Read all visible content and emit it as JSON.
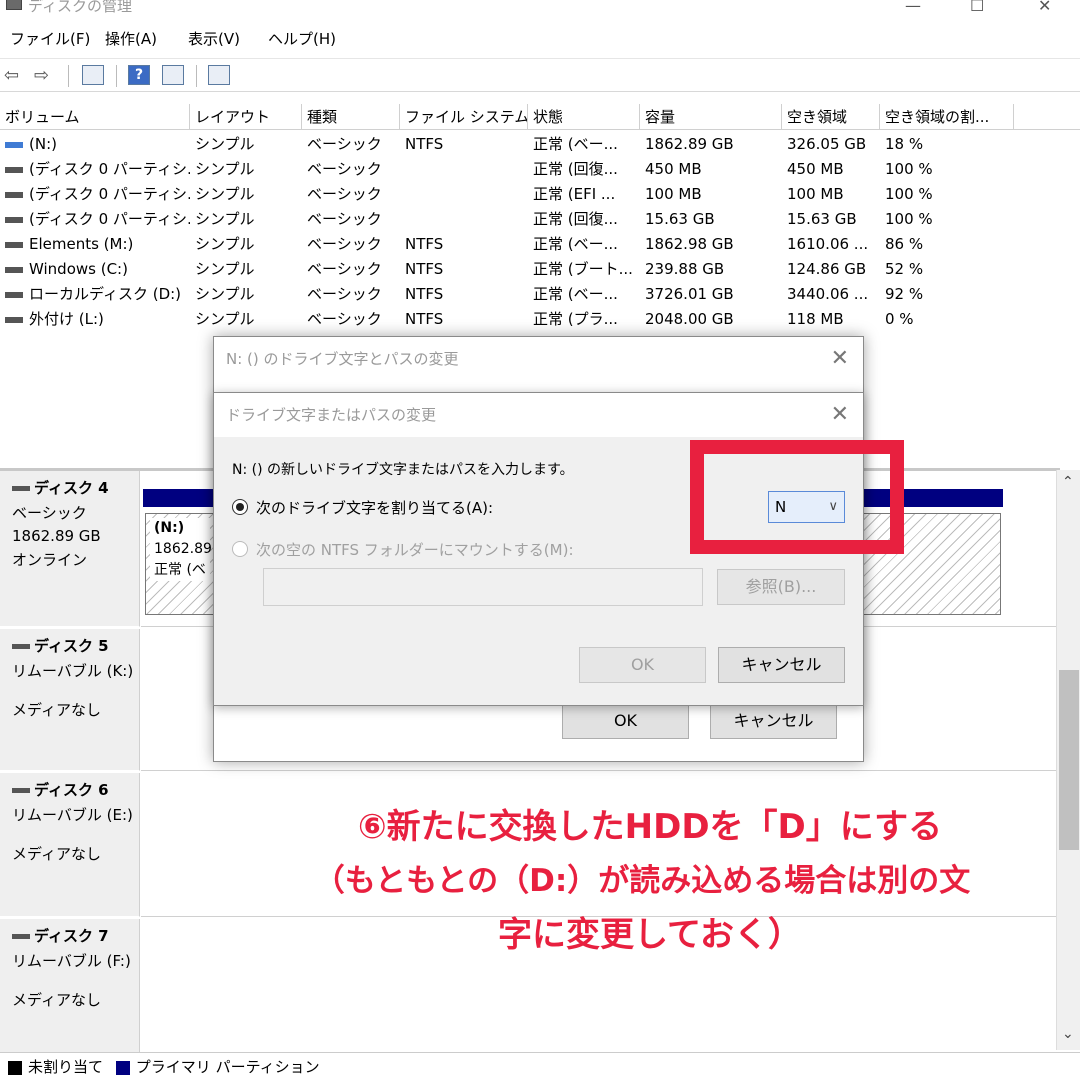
{
  "window": {
    "title": "ディスクの管理",
    "minimize": "—",
    "maximize": "☐",
    "close": "✕"
  },
  "menu": [
    "ファイル(F)",
    "操作(A)",
    "表示(V)",
    "ヘルプ(H)"
  ],
  "toolbar": {
    "back": "⇦",
    "forward": "⇨",
    "help": "?"
  },
  "table": {
    "headers": [
      "ボリューム",
      "レイアウト",
      "種類",
      "ファイル システム",
      "状態",
      "容量",
      "空き領域",
      "空き領域の割..."
    ],
    "rows": [
      [
        "(N:)",
        "シンプル",
        "ベーシック",
        "NTFS",
        "正常 (ベー...",
        "1862.89 GB",
        "326.05 GB",
        "18 %"
      ],
      [
        "(ディスク 0 パーティシ...",
        "シンプル",
        "ベーシック",
        "",
        "正常 (回復...",
        "450 MB",
        "450 MB",
        "100 %"
      ],
      [
        "(ディスク 0 パーティシ...",
        "シンプル",
        "ベーシック",
        "",
        "正常 (EFI ...",
        "100 MB",
        "100 MB",
        "100 %"
      ],
      [
        "(ディスク 0 パーティシ...",
        "シンプル",
        "ベーシック",
        "",
        "正常 (回復...",
        "15.63 GB",
        "15.63 GB",
        "100 %"
      ],
      [
        "Elements (M:)",
        "シンプル",
        "ベーシック",
        "NTFS",
        "正常 (ベー...",
        "1862.98 GB",
        "1610.06 ...",
        "86 %"
      ],
      [
        "Windows (C:)",
        "シンプル",
        "ベーシック",
        "NTFS",
        "正常 (ブート...",
        "239.88 GB",
        "124.86 GB",
        "52 %"
      ],
      [
        "ローカルディスク (D:)",
        "シンプル",
        "ベーシック",
        "NTFS",
        "正常 (ベー...",
        "3726.01 GB",
        "3440.06 ...",
        "92 %"
      ],
      [
        "外付け (L:)",
        "シンプル",
        "ベーシック",
        "NTFS",
        "正常 (プラ...",
        "2048.00 GB",
        "118 MB",
        "0 %"
      ]
    ]
  },
  "disks": [
    {
      "name": "ディスク 4",
      "type": "ベーシック",
      "size": "1862.89 GB",
      "status": "オンライン",
      "part_name": "(N:)",
      "part_size": "1862.89",
      "part_status": "正常 (ベ"
    },
    {
      "name": "ディスク 5",
      "type": "リムーバブル (K:)",
      "size": "",
      "status": "メディアなし"
    },
    {
      "name": "ディスク 6",
      "type": "リムーバブル (E:)",
      "size": "",
      "status": "メディアなし"
    },
    {
      "name": "ディスク 7",
      "type": "リムーバブル (F:)",
      "size": "",
      "status": "メディアなし"
    }
  ],
  "legend": {
    "unallocated": "未割り当て",
    "primary": "プライマリ パーティション",
    "unallocated_color": "#000000",
    "primary_color": "#000080"
  },
  "outer_dialog": {
    "title": "N: () のドライブ文字とパスの変更",
    "ok": "OK",
    "cancel": "キャンセル"
  },
  "inner_dialog": {
    "title": "ドライブ文字またはパスの変更",
    "prompt": "N: () の新しいドライブ文字またはパスを入力します。",
    "assign_label": "次のドライブ文字を割り当てる(A):",
    "drive_letter": "N",
    "mount_label": "次の空の NTFS フォルダーにマウントする(M):",
    "browse": "参照(B)...",
    "ok": "OK",
    "cancel": "キャンセル"
  },
  "annotation": {
    "line1": "⑥新たに交換したHDDを「D」にする",
    "line2": "（もともとの（D:）が読み込める場合は別の文",
    "line3": "字に変更しておく）",
    "color": "#e8203f"
  }
}
